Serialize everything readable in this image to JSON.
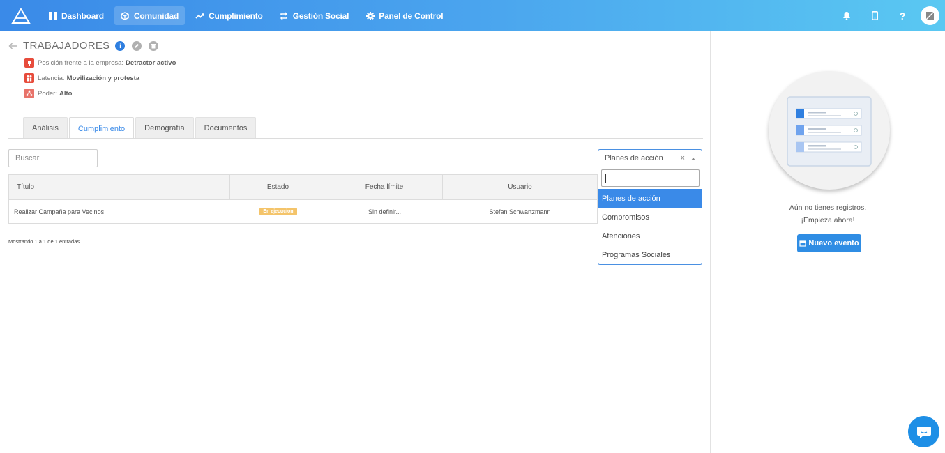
{
  "nav": {
    "items": [
      {
        "label": "Dashboard",
        "icon": "dashboard-icon"
      },
      {
        "label": "Comunidad",
        "icon": "cube-icon",
        "active": true
      },
      {
        "label": "Cumplimiento",
        "icon": "trend-icon"
      },
      {
        "label": "Gestión Social",
        "icon": "repeat-icon"
      },
      {
        "label": "Panel de Control",
        "icon": "gear-icon"
      }
    ],
    "help_label": "?"
  },
  "page": {
    "title": "TRABAJADORES",
    "attributes": [
      {
        "label": "Posición frente a la empresa:",
        "value": "Detractor activo",
        "color": "#e74c3c"
      },
      {
        "label": "Latencia:",
        "value": "Movilización y protesta",
        "color": "#e74c3c"
      },
      {
        "label": "Poder:",
        "value": "Alto",
        "color": "#e8736a"
      }
    ]
  },
  "tabs": [
    {
      "label": "Análisis"
    },
    {
      "label": "Cumplimiento",
      "active": true
    },
    {
      "label": "Demografía"
    },
    {
      "label": "Documentos"
    }
  ],
  "search": {
    "placeholder": "Buscar"
  },
  "select": {
    "value": "Planes de acción",
    "clear": "×",
    "options": [
      "Planes de acción",
      "Compromisos",
      "Atenciones",
      "Programas Sociales"
    ]
  },
  "table": {
    "headers": [
      "Título",
      "Estado",
      "Fecha límite",
      "Usuario"
    ],
    "rows": [
      {
        "titulo": "Realizar Campaña para Vecinos",
        "estado": "En ejecucion",
        "fecha": "Sin definir...",
        "usuario": "Stefan Schwartzmann"
      }
    ],
    "entries": "Mostrando 1 a 1 de 1 entradas"
  },
  "right": {
    "empty_line1": "Aún no tienes registros.",
    "empty_line2": "¡Empieza ahora!",
    "new_button": "Nuevo evento"
  },
  "colors": {
    "accent": "#3a8ae8",
    "status_pending": "#f4c46a"
  }
}
